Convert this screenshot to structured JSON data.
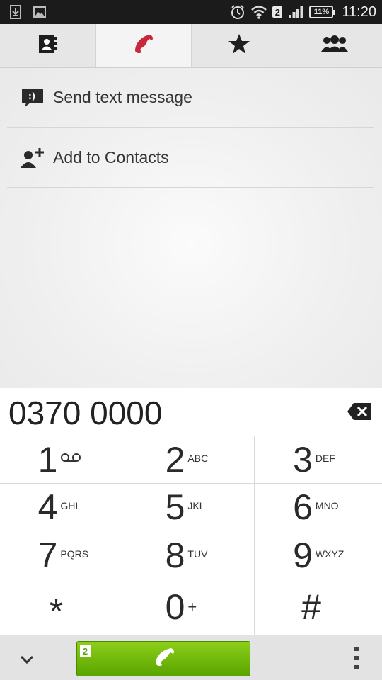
{
  "status_bar": {
    "time": "11:20",
    "battery": "11%",
    "sim_slot": "2",
    "icons": [
      "download-icon",
      "image-icon",
      "alarm-icon",
      "wifi-icon",
      "signal-icon",
      "battery-icon"
    ]
  },
  "tabs": [
    {
      "name": "contacts",
      "icon": "contact-book-icon",
      "active": false
    },
    {
      "name": "phone",
      "icon": "phone-handset-icon",
      "active": true
    },
    {
      "name": "favorites",
      "icon": "star-icon",
      "active": false
    },
    {
      "name": "groups",
      "icon": "groups-icon",
      "active": false
    }
  ],
  "actions": [
    {
      "label": "Send text message",
      "icon": "message-icon"
    },
    {
      "label": "Add to Contacts",
      "icon": "add-contact-icon"
    }
  ],
  "dial": {
    "number": "0370 0000"
  },
  "keypad": [
    {
      "digit": "1",
      "letters": "",
      "extra_icon": "voicemail-icon"
    },
    {
      "digit": "2",
      "letters": "ABC"
    },
    {
      "digit": "3",
      "letters": "DEF"
    },
    {
      "digit": "4",
      "letters": "GHI"
    },
    {
      "digit": "5",
      "letters": "JKL"
    },
    {
      "digit": "6",
      "letters": "MNO"
    },
    {
      "digit": "7",
      "letters": "PQRS"
    },
    {
      "digit": "8",
      "letters": "TUV"
    },
    {
      "digit": "9",
      "letters": "WXYZ"
    },
    {
      "digit": "*",
      "letters": ""
    },
    {
      "digit": "0",
      "letters": "+"
    },
    {
      "digit": "#",
      "letters": ""
    }
  ],
  "bottom": {
    "call_sim": "2",
    "accent": "#6fba0a"
  },
  "colors": {
    "active_phone_icon": "#c8283c",
    "call_green": "#6fba0a"
  }
}
